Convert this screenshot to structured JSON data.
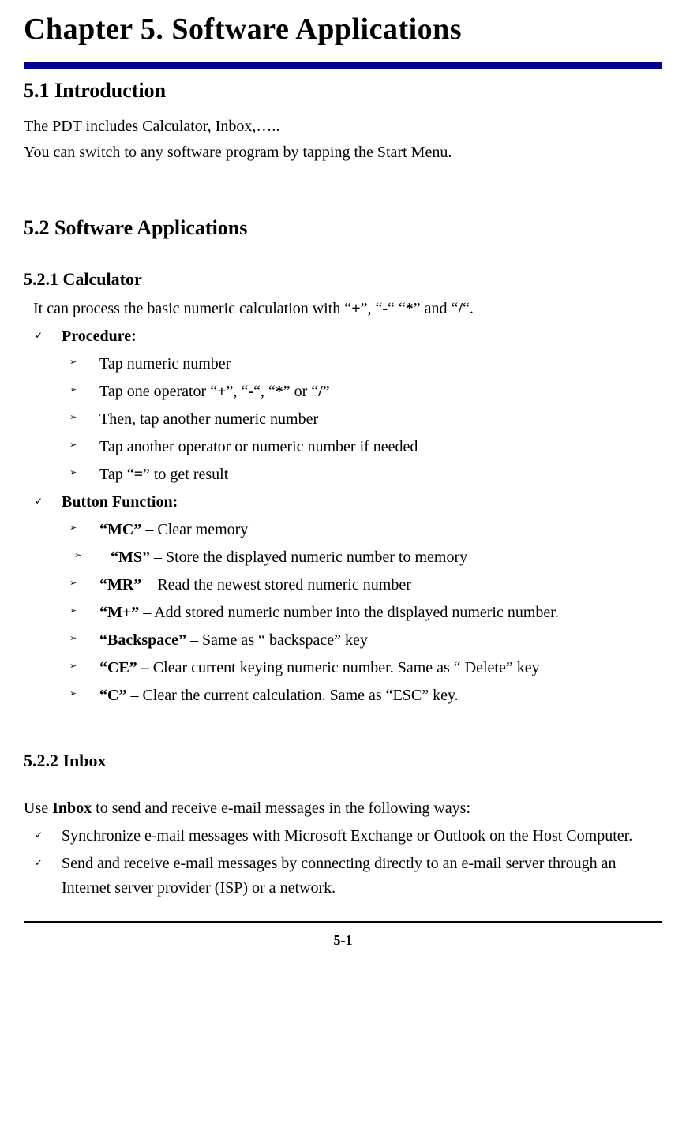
{
  "chapter": {
    "prefix": "Chapter 5.",
    "title": "Software Applications"
  },
  "s1": {
    "heading": "5.1 Introduction",
    "p1": "The PDT includes Calculator, Inbox,…..",
    "p2": "You can switch to any software program by tapping the Start Menu."
  },
  "s2": {
    "heading": "5.2 Software Applications",
    "calculator": {
      "heading": "5.2.1 Calculator",
      "intro_a": "It can process the basic numeric calculation with “",
      "intro_plus": "+",
      "intro_b": "”, “",
      "intro_minus": "-",
      "intro_c": "“ “",
      "intro_star": "*",
      "intro_d": "” and “",
      "intro_slash": "/",
      "intro_e": "“.",
      "procedure_label": "Procedure:",
      "procedure": {
        "step1": "Tap numeric number",
        "step2_a": "Tap one operator “",
        "step2_plus": "+",
        "step2_b": "”, “",
        "step2_minus": "-",
        "step2_c": "“, “",
        "step2_star": "*",
        "step2_d": "” or “",
        "step2_slash": "/",
        "step2_e": "”",
        "step3": "Then, tap another numeric number",
        "step4": "Tap another operator or numeric number if needed",
        "step5_a": "Tap “",
        "step5_eq": "=",
        "step5_b": "” to get result"
      },
      "button_function_label": "Button Function:",
      "buttons": {
        "mc": {
          "label": "“MC” – ",
          "desc": "Clear memory"
        },
        "ms": {
          "label": "“MS”",
          "desc": " – Store the displayed numeric number to memory"
        },
        "mr": {
          "label": "“MR”",
          "desc": " – Read the newest stored numeric number"
        },
        "mplus": {
          "label": "“M+”",
          "desc": " – Add stored numeric number into the displayed numeric number."
        },
        "backspace": {
          "label": "“Backspace”",
          "desc": " – Same as “ backspace” key"
        },
        "ce": {
          "label": "“CE” – ",
          "desc": "Clear current keying numeric number. Same as “ Delete” key"
        },
        "c": {
          "label": "“C”",
          "desc": " – Clear the current calculation. Same as “ESC” key."
        }
      }
    },
    "inbox": {
      "heading": "5.2.2 Inbox",
      "intro_a": "Use ",
      "intro_bold": "Inbox",
      "intro_b": " to send and receive e-mail messages in the following ways:",
      "items": {
        "sync": "Synchronize e-mail messages with Microsoft Exchange or Outlook on the Host Computer.",
        "direct": "Send and receive e-mail messages by connecting directly to an e-mail server through an Internet server provider (ISP) or a network."
      }
    }
  },
  "page_number": "5-1"
}
